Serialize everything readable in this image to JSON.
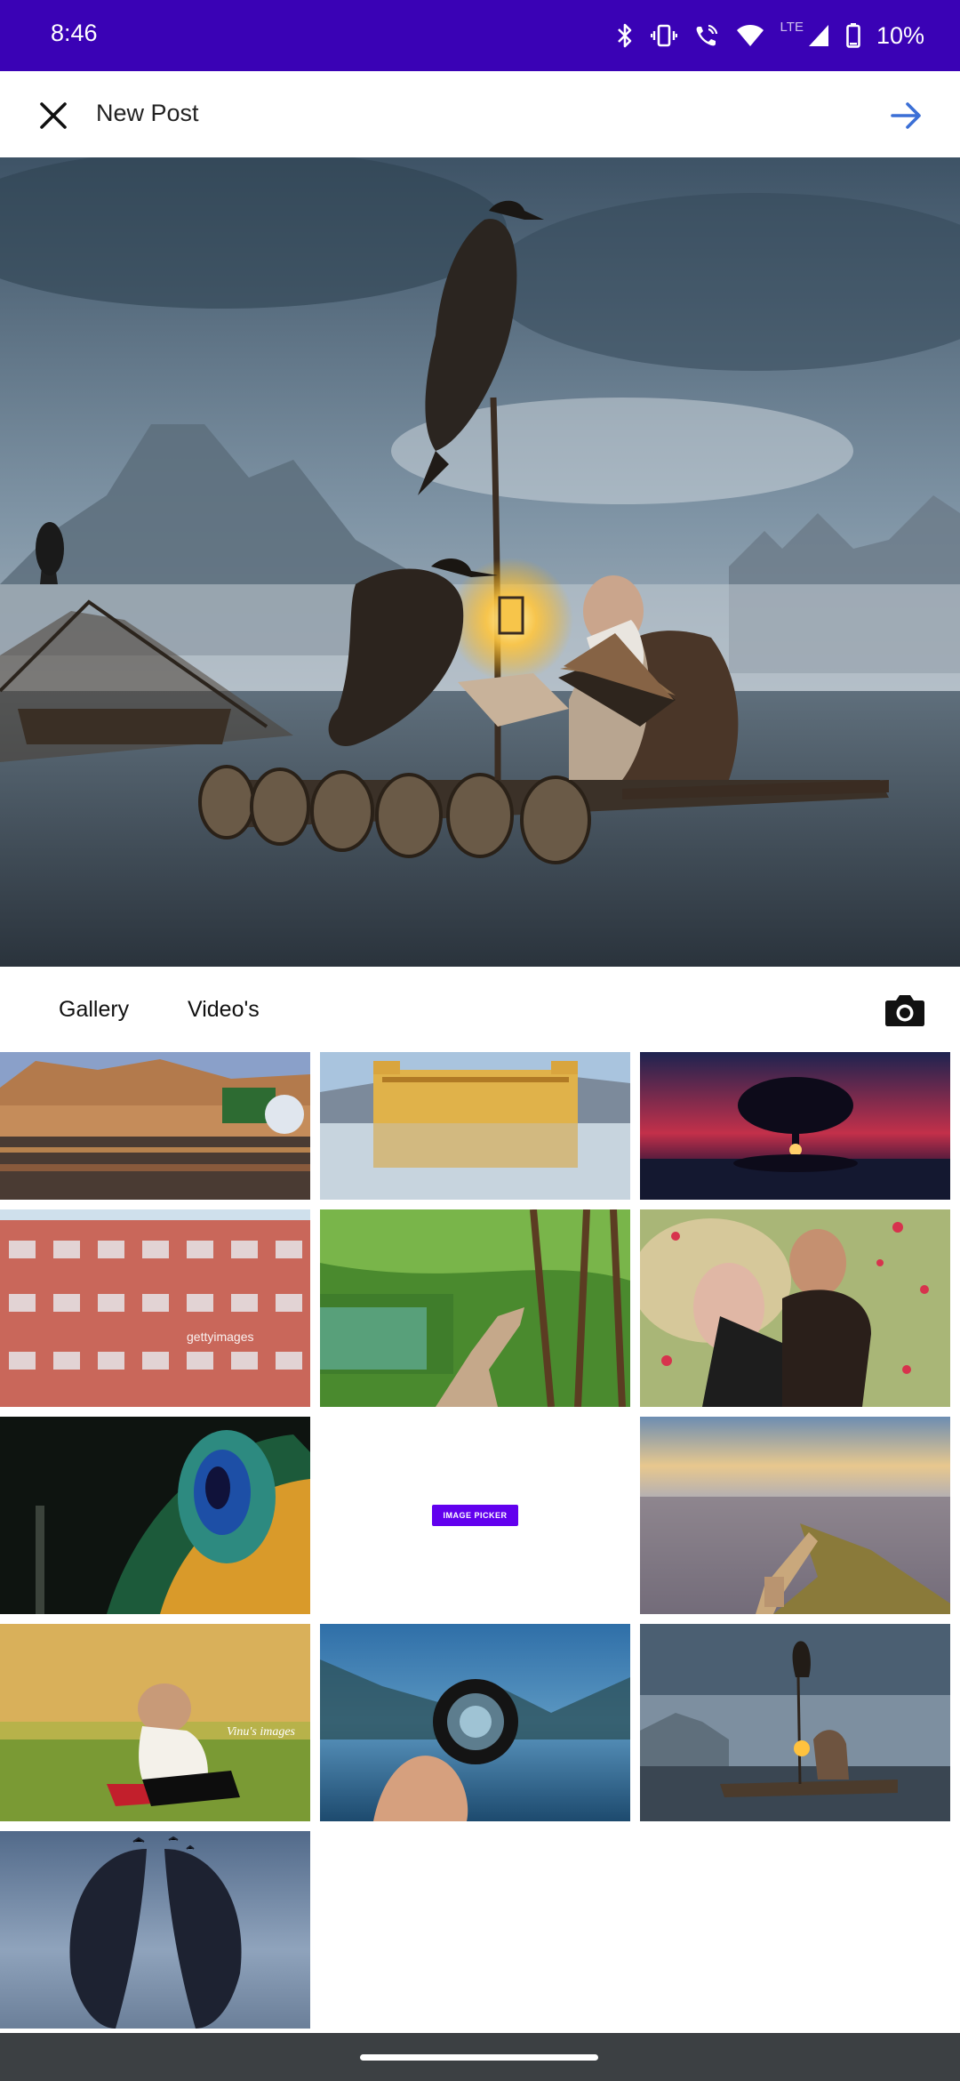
{
  "status_bar": {
    "time": "8:46",
    "network": "LTE",
    "battery": "10%",
    "icons": [
      "bluetooth-icon",
      "vibrate-icon",
      "wifi-call-icon",
      "wifi-icon",
      "signal-icon",
      "battery-icon"
    ],
    "background_color": "#3a02b5"
  },
  "app_bar": {
    "title": "New Post",
    "close_icon": "close-icon",
    "next_icon": "arrow-right-icon",
    "accent_color": "#3b6fd6"
  },
  "tabs": {
    "items": [
      {
        "label": "Gallery"
      },
      {
        "label": "Video's"
      }
    ],
    "camera_icon": "camera-icon"
  },
  "gallery": {
    "thumbnails": [
      {
        "subject": "palace-lake"
      },
      {
        "subject": "water-palace"
      },
      {
        "subject": "tree-sunset"
      },
      {
        "subject": "pink-palace-facade"
      },
      {
        "subject": "forest-boardwalk"
      },
      {
        "subject": "couple-portrait"
      },
      {
        "subject": "peacock-feather"
      },
      {
        "subject": "image-picker"
      },
      {
        "subject": "city-fort-wall"
      },
      {
        "subject": "child-piano"
      },
      {
        "subject": "hand-lens"
      },
      {
        "subject": "fisherman-cormorants"
      },
      {
        "subject": "dark-wings"
      }
    ],
    "image_picker_label": "IMAGE PICKER",
    "image_picker_color": "#6200ee",
    "photo_watermarks": [
      "gettyimages",
      "Vinu's images"
    ]
  }
}
